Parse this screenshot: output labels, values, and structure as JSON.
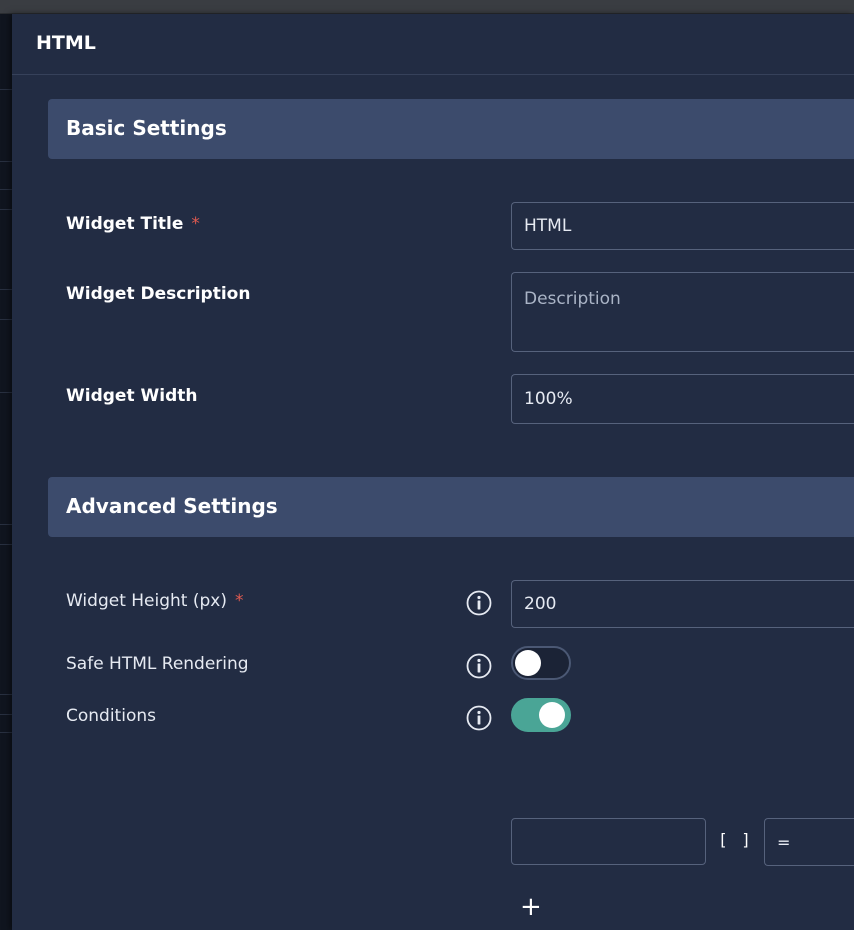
{
  "modal": {
    "title": "HTML"
  },
  "basic_settings": {
    "section_title": "Basic Settings",
    "widget_title": {
      "label": "Widget Title",
      "required_mark": "*",
      "value": "HTML"
    },
    "widget_description": {
      "label": "Widget Description",
      "placeholder": "Description"
    },
    "widget_width": {
      "label": "Widget Width",
      "value": "100%"
    }
  },
  "advanced_settings": {
    "section_title": "Advanced Settings",
    "widget_height": {
      "label": "Widget Height (px)",
      "required_mark": "*",
      "value": "200",
      "info_icon": "info-icon"
    },
    "safe_html_rendering": {
      "label": "Safe HTML Rendering",
      "enabled": false,
      "info_icon": "info-icon"
    },
    "conditions": {
      "label": "Conditions",
      "enabled": true,
      "info_icon": "info-icon",
      "row": {
        "field_value": "",
        "array_marker": "[ ]",
        "operator": "="
      },
      "add_label": "+"
    }
  },
  "colors": {
    "modal_bg": "#222c43",
    "section_bg": "#3c4b6c",
    "toggle_on": "#4aa596",
    "required": "#e05a50"
  }
}
